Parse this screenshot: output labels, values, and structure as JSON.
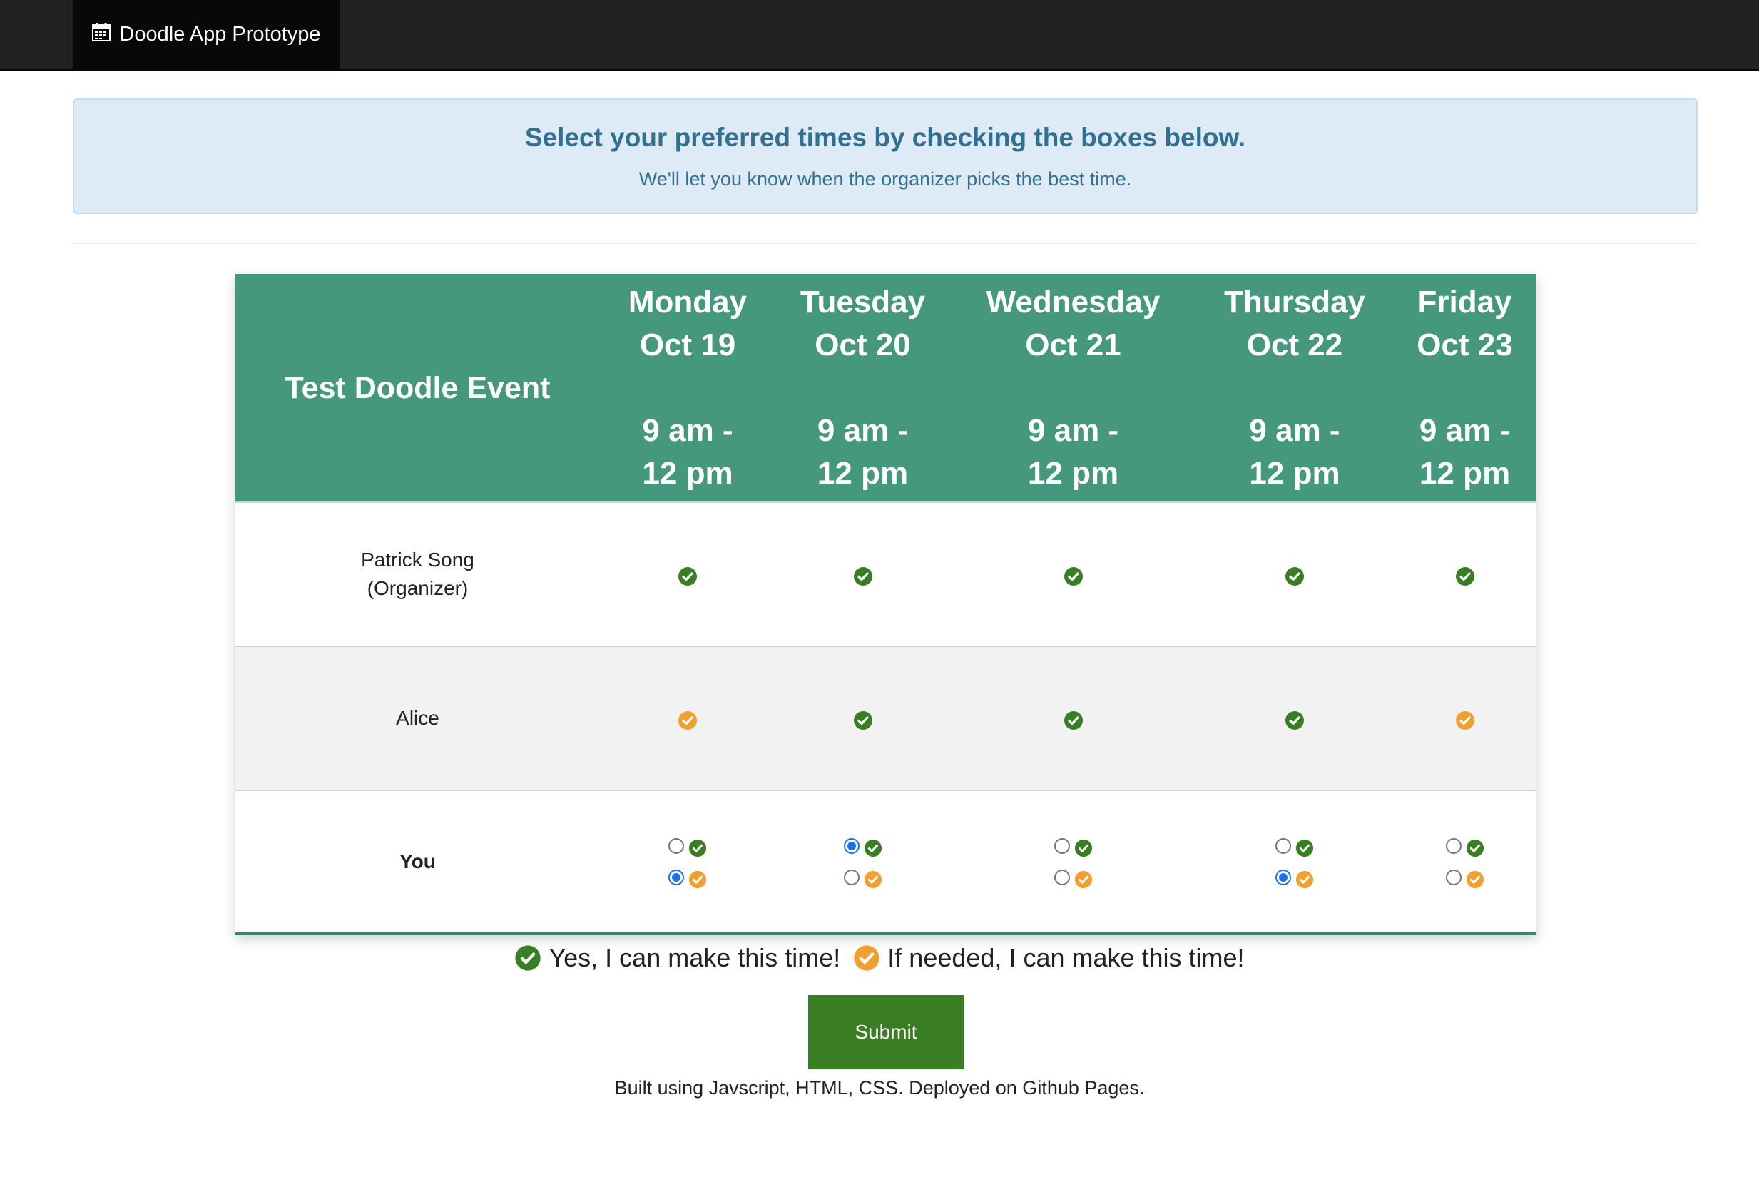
{
  "navbar": {
    "brand": "Doodle App Prototype",
    "brand_icon": "calendar-icon"
  },
  "alert": {
    "title": "Select your preferred times by checking the boxes below.",
    "subtitle": "We'll let you know when the organizer picks the best time."
  },
  "table": {
    "event_name": "Test Doodle Event",
    "days": [
      {
        "day": "Monday",
        "date": "Oct 19",
        "time_start": "9 am -",
        "time_end": "12 pm"
      },
      {
        "day": "Tuesday",
        "date": "Oct 20",
        "time_start": "9 am -",
        "time_end": "12 pm"
      },
      {
        "day": "Wednesday",
        "date": "Oct 21",
        "time_start": "9 am -",
        "time_end": "12 pm"
      },
      {
        "day": "Thursday",
        "date": "Oct 22",
        "time_start": "9 am -",
        "time_end": "12 pm"
      },
      {
        "day": "Friday",
        "date": "Oct 23",
        "time_start": "9 am -",
        "time_end": "12 pm"
      }
    ],
    "participants": [
      {
        "name_line1": "Patrick Song",
        "name_line2": "(Organizer)",
        "answers": [
          "yes",
          "yes",
          "yes",
          "yes",
          "yes"
        ]
      },
      {
        "name_line1": "Alice",
        "name_line2": "",
        "answers": [
          "ifneeded",
          "yes",
          "yes",
          "yes",
          "ifneeded"
        ]
      }
    ],
    "you": {
      "label": "You",
      "selections": [
        "ifneeded",
        "yes",
        "none",
        "ifneeded",
        "none"
      ]
    }
  },
  "legend": {
    "yes_label": "Yes, I can make this time!",
    "ifneeded_label": "If needed, I can make this time!"
  },
  "submit_label": "Submit",
  "footer": "Built using Javscript, HTML, CSS. Deployed on Github Pages.",
  "colors": {
    "header_green": "#45977d",
    "yes": "#3a7e23",
    "ifneeded": "#f0a030",
    "radio_selected": "#1a73e8"
  }
}
